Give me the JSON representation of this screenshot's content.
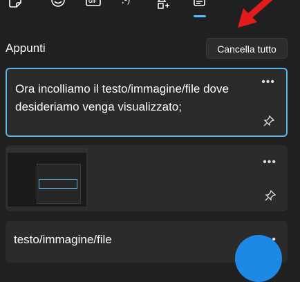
{
  "tabs": [
    {
      "name": "gif-sticker",
      "icon": "sticker-icon"
    },
    {
      "name": "emoji",
      "icon": "emoji-icon"
    },
    {
      "name": "gif",
      "icon": "gif-icon"
    },
    {
      "name": "kaomoji",
      "icon": "kaomoji-icon"
    },
    {
      "name": "symbols",
      "icon": "symbols-icon"
    },
    {
      "name": "clipboard",
      "icon": "clipboard-icon",
      "active": true
    }
  ],
  "section": {
    "title": "Appunti"
  },
  "clear_button": {
    "label": "Cancella tutto"
  },
  "items": [
    {
      "type": "text",
      "text": "Ora incolliamo il testo/immagine/file dove desideriamo venga visualizzato;",
      "selected": true
    },
    {
      "type": "image",
      "selected": false
    },
    {
      "type": "text",
      "text": "testo/immagine/file",
      "selected": false
    }
  ],
  "colors": {
    "accent": "#5ab5e6",
    "tab_indicator": "#4cc2ff",
    "arrow": "#e31b1b",
    "background": "#202020",
    "card": "#2b2b2b"
  }
}
